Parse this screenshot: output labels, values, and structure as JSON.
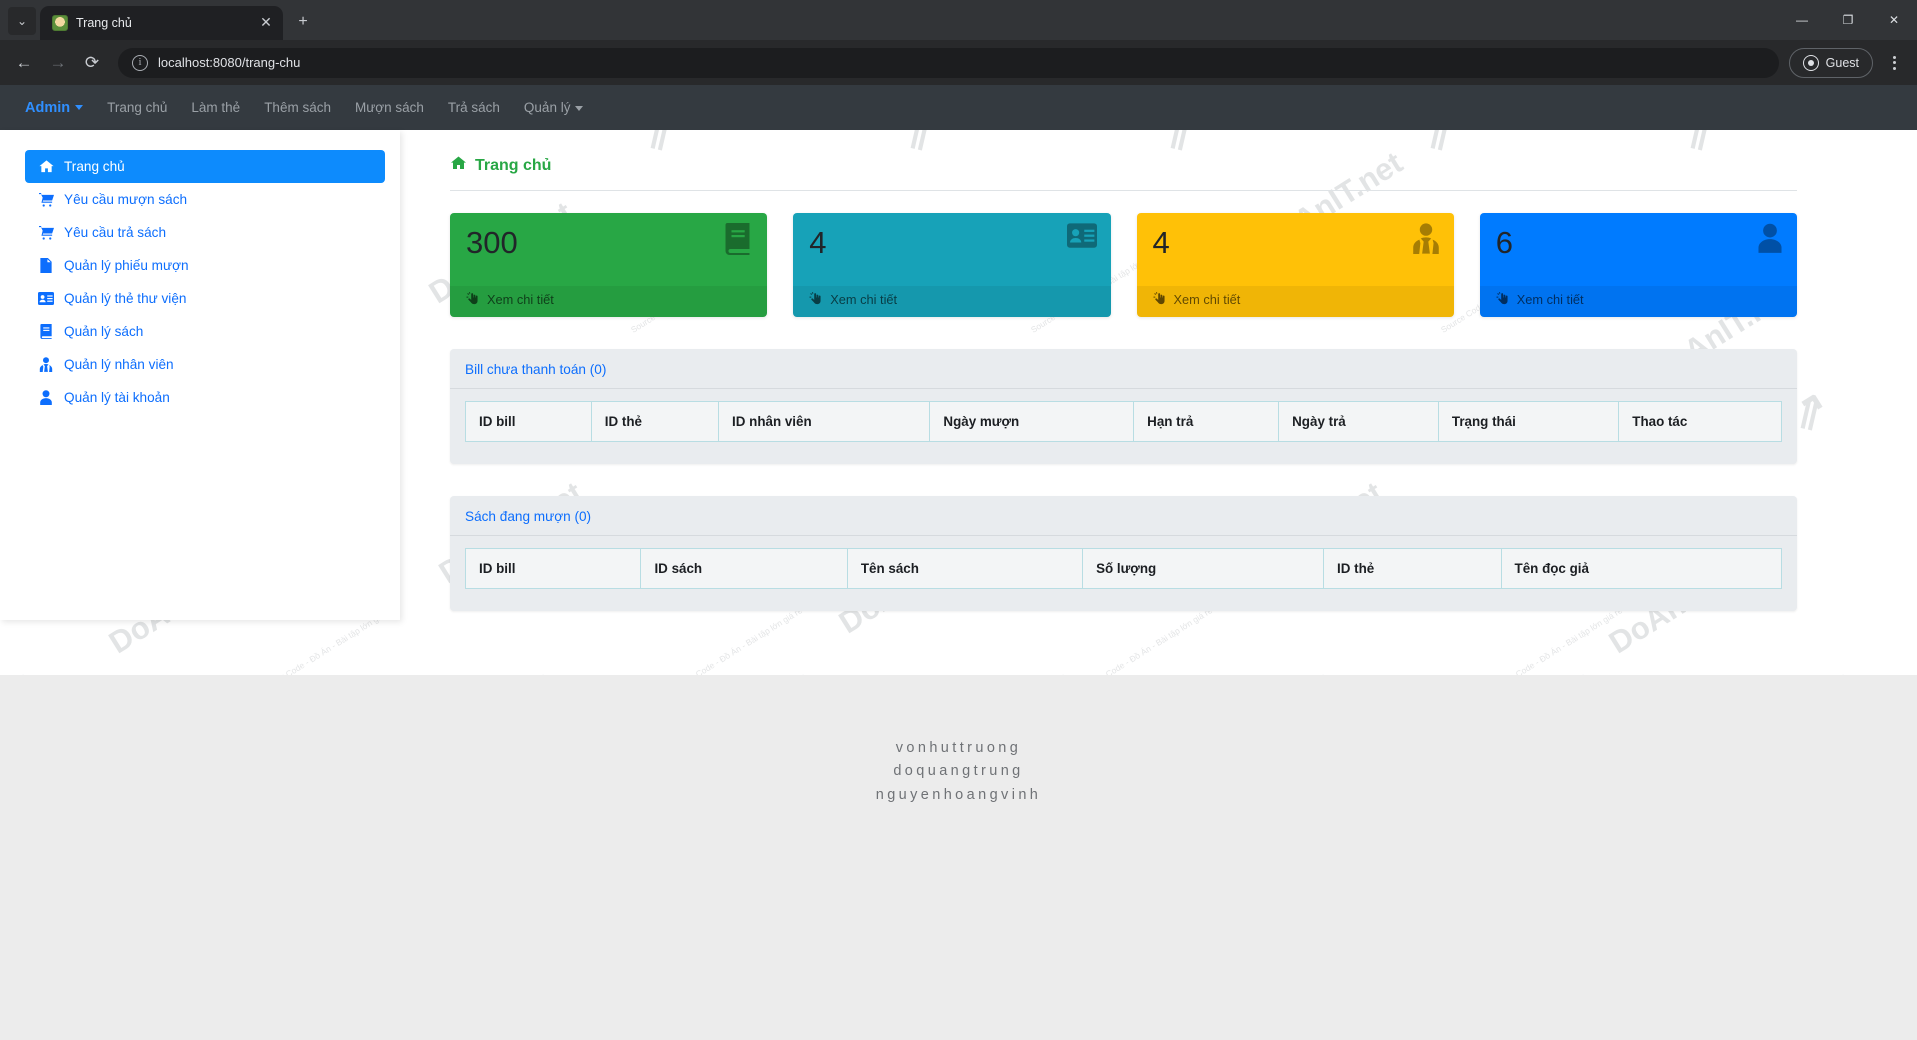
{
  "browser": {
    "tab_title": "Trang chủ",
    "tab_close_glyph": "✕",
    "new_tab_glyph": "+",
    "tab_list_glyph": "⌄",
    "back_glyph": "←",
    "forward_glyph": "→",
    "reload_glyph": "⟳",
    "info_glyph": "i",
    "url": "localhost:8080/trang-chu",
    "profile_label": "Guest",
    "minimize_glyph": "—",
    "maximize_glyph": "❐",
    "close_glyph": "✕"
  },
  "navbar": {
    "brand": "Admin",
    "links": [
      {
        "label": "Trang chủ",
        "caret": false
      },
      {
        "label": "Làm thẻ",
        "caret": false
      },
      {
        "label": "Thêm sách",
        "caret": false
      },
      {
        "label": "Mượn sách",
        "caret": false
      },
      {
        "label": "Trả sách",
        "caret": false
      },
      {
        "label": "Quản lý",
        "caret": true
      }
    ]
  },
  "sidebar": {
    "items": [
      {
        "label": "Trang chủ",
        "icon": "home-icon",
        "glyph": "⌂",
        "active": true
      },
      {
        "label": "Yêu cầu mượn sách",
        "icon": "cart-icon",
        "glyph": "🛒",
        "active": false
      },
      {
        "label": "Yêu cầu trả sách",
        "icon": "cart-icon",
        "glyph": "🛒",
        "active": false
      },
      {
        "label": "Quản lý phiếu mượn",
        "icon": "invoice-icon",
        "glyph": "🧾",
        "active": false
      },
      {
        "label": "Quản lý thẻ thư viện",
        "icon": "id-card-icon",
        "glyph": "🪪",
        "active": false
      },
      {
        "label": "Quản lý sách",
        "icon": "book-icon",
        "glyph": "📕",
        "active": false
      },
      {
        "label": "Quản lý nhân viên",
        "icon": "user-tie-icon",
        "glyph": "👤",
        "active": false
      },
      {
        "label": "Quản lý tài khoản",
        "icon": "user-icon",
        "glyph": "👤",
        "active": false
      }
    ]
  },
  "main": {
    "page_title": "Trang chủ",
    "page_title_icon": "home-icon",
    "cards": [
      {
        "value": "300",
        "link": "Xem chi tiết",
        "color": "#28a745",
        "icon": "book-icon"
      },
      {
        "value": "4",
        "link": "Xem chi tiết",
        "color": "#17a2b8",
        "icon": "id-card-icon"
      },
      {
        "value": "4",
        "link": "Xem chi tiết",
        "color": "#ffc107",
        "icon": "user-tie-icon"
      },
      {
        "value": "6",
        "link": "Xem chi tiết",
        "color": "#007bff",
        "icon": "user-icon"
      }
    ],
    "panels": [
      {
        "title": "Bill chưa thanh toán (0)",
        "columns": [
          "ID bill",
          "ID thẻ",
          "ID nhân viên",
          "Ngày mượn",
          "Hạn trả",
          "Ngày trả",
          "Trạng thái",
          "Thao tác"
        ],
        "rows": []
      },
      {
        "title": "Sách đang mượn (0)",
        "columns": [
          "ID bill",
          "ID sách",
          "Tên sách",
          "Số lượng",
          "ID thẻ",
          "Tên đọc giả"
        ],
        "rows": []
      }
    ]
  },
  "footer": {
    "names": [
      "vonhuttruong",
      "doquangtrung",
      "nguyenhoangvinh"
    ]
  },
  "watermark": {
    "brand": "DoAnIT.net",
    "tagline": "Source Code - Đồ Án - Bài tập lớn giá rẻ"
  }
}
